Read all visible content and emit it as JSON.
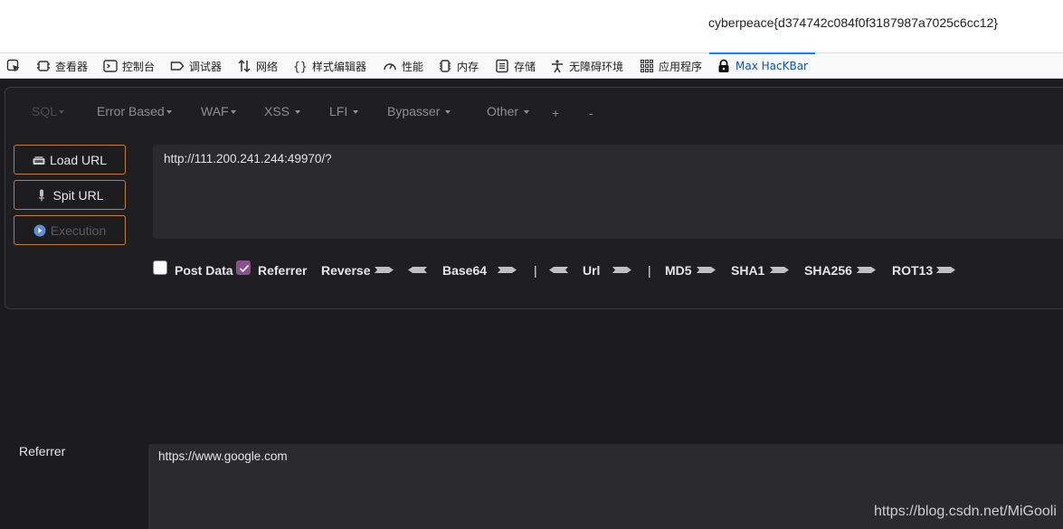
{
  "page": {
    "flag_text": "cyberpeace{d374742c084f0f3187987a7025c6cc12}"
  },
  "devtools": {
    "tabs": [
      {
        "label": "",
        "icon": "pick-element-icon"
      },
      {
        "label": "查看器",
        "icon": "inspector-icon"
      },
      {
        "label": "控制台",
        "icon": "console-icon"
      },
      {
        "label": "调试器",
        "icon": "debugger-icon"
      },
      {
        "label": "网络",
        "icon": "network-icon"
      },
      {
        "label": "样式编辑器",
        "icon": "style-editor-icon"
      },
      {
        "label": "性能",
        "icon": "performance-icon"
      },
      {
        "label": "内存",
        "icon": "memory-icon"
      },
      {
        "label": "存储",
        "icon": "storage-icon"
      },
      {
        "label": "无障碍环境",
        "icon": "accessibility-icon"
      },
      {
        "label": "应用程序",
        "icon": "application-icon"
      },
      {
        "label": "Max HacKBar",
        "icon": "hackbar-lock-icon"
      }
    ]
  },
  "hackbar": {
    "menu": [
      "SQL",
      "Error Based",
      "WAF",
      "XSS",
      "LFI",
      "Bypasser",
      "Other",
      "+",
      "-"
    ],
    "buttons": {
      "load": "Load URL",
      "split": "Spit URL",
      "execute": "Execution"
    },
    "url_value": "http://111.200.241.244:49970/?",
    "options": {
      "post_data": "Post Data",
      "referrer": "Referrer",
      "reverse": "Reverse",
      "base64": "Base64",
      "sep1": "|",
      "url": "Url",
      "sep2": "|",
      "md5": "MD5",
      "sha1": "SHA1",
      "sha256": "SHA256",
      "rot13": "ROT13"
    },
    "post_data_checked": false,
    "referrer_checked": true,
    "referrer_label": "Referrer",
    "referrer_value": "https://www.google.com"
  },
  "watermark": "https://blog.csdn.net/MiGooli",
  "colors": {
    "accent": "#c07d35",
    "checkbox_on": "#8a4f8e",
    "active_tab": "#0a56b9"
  }
}
